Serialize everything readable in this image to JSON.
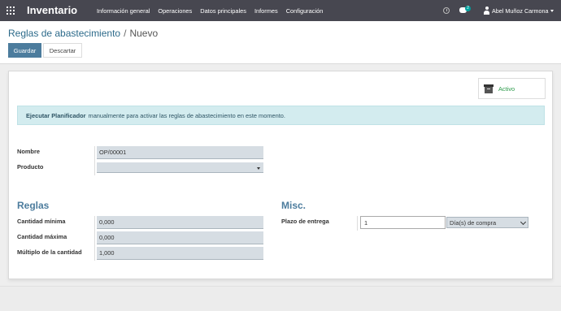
{
  "navbar": {
    "app_title": "Inventario",
    "menu": [
      "Información general",
      "Operaciones",
      "Datos principales",
      "Informes",
      "Configuración"
    ],
    "chat_badge": "2",
    "user_name": "Abel Muñoz Carmona",
    "icons": [
      "apps-grid-icon",
      "clock-icon",
      "chat-icon",
      "user-icon",
      "caret-down-icon"
    ]
  },
  "breadcrumb": {
    "parent": "Reglas de abastecimiento",
    "separator": "/",
    "current": "Nuevo"
  },
  "buttons": {
    "save": "Guardar",
    "discard": "Descartar"
  },
  "colors": {
    "navbar": "#474750",
    "primary": "#4c7c9d",
    "active_green": "#2b9a4a",
    "info_bg": "#d3ecef",
    "badge": "#00a09d"
  },
  "form": {
    "active_button": "Activo",
    "alert": {
      "bold": "Ejecutar Planificador",
      "text": "manualmente para activar las reglas de abastecimiento en este momento."
    },
    "name_label": "Nombre",
    "name_value": "OP/00001",
    "product_label": "Producto",
    "product_value": "",
    "rules_section": "Reglas",
    "min_label": "Cantidad mínima",
    "min_value": "0,000",
    "max_label": "Cantidad máxima",
    "max_value": "0,000",
    "multiple_label": "Múltiplo de la cantidad",
    "multiple_value": "1,000",
    "misc_section": "Misc.",
    "lead_label": "Plazo de entrega",
    "lead_value": "1",
    "lead_unit": "Día(s) de compra"
  }
}
